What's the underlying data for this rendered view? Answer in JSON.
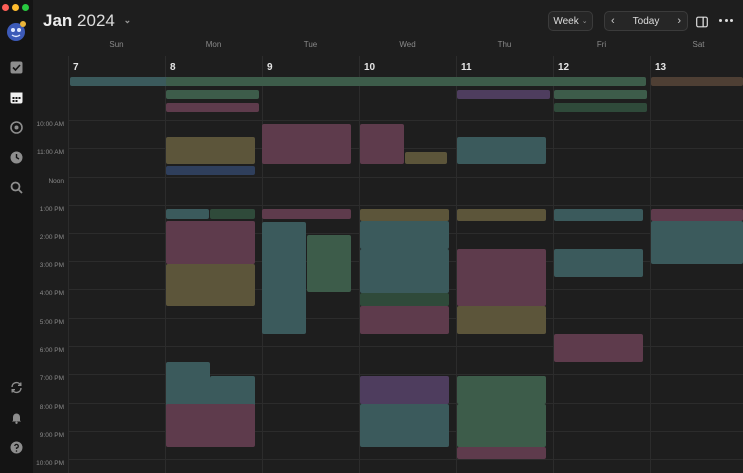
{
  "header": {
    "month": "Jan",
    "year": "2024",
    "view_label": "Week",
    "today_label": "Today"
  },
  "days": [
    {
      "name": "Sun",
      "date": "7"
    },
    {
      "name": "Mon",
      "date": "8"
    },
    {
      "name": "Tue",
      "date": "9"
    },
    {
      "name": "Wed",
      "date": "10"
    },
    {
      "name": "Thu",
      "date": "11"
    },
    {
      "name": "Fri",
      "date": "12"
    },
    {
      "name": "Sat",
      "date": "13"
    }
  ],
  "times": [
    "10:00 AM",
    "11:00 AM",
    "Noon",
    "1:00 PM",
    "2:00 PM",
    "3:00 PM",
    "4:00 PM",
    "5:00 PM",
    "6:00 PM",
    "7:00 PM",
    "8:00 PM",
    "9:00 PM",
    "10:00 PM"
  ],
  "colors": {
    "red": "#ff5f57",
    "yellow": "#febc2e",
    "green": "#28c840"
  },
  "icons": [
    "app-logo-icon",
    "checkbox-icon",
    "calendar-icon",
    "target-icon",
    "clock-icon",
    "search-icon",
    "sync-icon",
    "bell-icon",
    "help-icon"
  ],
  "events": [
    {
      "title": "",
      "sub": "",
      "color": "teal"
    },
    {
      "title": "",
      "sub": "",
      "color": "green"
    },
    {
      "title": "",
      "sub": "",
      "color": "green"
    },
    {
      "title": "",
      "sub": "",
      "color": "pink"
    },
    {
      "title": "",
      "sub": "",
      "color": "purple"
    },
    {
      "title": "",
      "sub": "",
      "color": "green"
    },
    {
      "title": "",
      "sub": "",
      "color": "dgreen"
    },
    {
      "title": "",
      "sub": "",
      "color": "brown"
    },
    {
      "title": "",
      "sub": "",
      "color": "olive"
    },
    {
      "title": "",
      "sub": "",
      "color": "blue"
    },
    {
      "title": "",
      "sub": "",
      "color": "pink"
    },
    {
      "title": "",
      "sub": "",
      "color": "pink"
    },
    {
      "title": "",
      "sub": "",
      "color": "olive"
    },
    {
      "title": "",
      "sub": "",
      "color": "teal"
    },
    {
      "title": "",
      "sub": "",
      "color": "teal"
    },
    {
      "title": "",
      "sub": "",
      "color": "dgreen"
    },
    {
      "title": "",
      "sub": "",
      "color": "pink"
    },
    {
      "title": "",
      "sub": "",
      "color": "olive"
    },
    {
      "title": "",
      "sub": "",
      "color": "pink"
    },
    {
      "title": "",
      "sub": "",
      "color": "teal"
    },
    {
      "title": "",
      "sub": "",
      "color": "green"
    },
    {
      "title": "",
      "sub": "",
      "color": "olive"
    },
    {
      "title": "",
      "sub": "",
      "color": "teal"
    },
    {
      "title": "",
      "sub": "",
      "color": "teal"
    },
    {
      "title": "",
      "sub": "",
      "color": "dgreen"
    },
    {
      "title": "",
      "sub": "",
      "color": "pink"
    },
    {
      "title": "",
      "sub": "",
      "color": "olive"
    },
    {
      "title": "",
      "sub": "",
      "color": "pink"
    },
    {
      "title": "",
      "sub": "",
      "color": "olive"
    },
    {
      "title": "",
      "sub": "",
      "color": "teal"
    },
    {
      "title": "",
      "sub": "",
      "color": "teal"
    },
    {
      "title": "",
      "sub": "",
      "color": "pink"
    },
    {
      "title": "",
      "sub": "",
      "color": "teal"
    },
    {
      "title": "",
      "sub": "",
      "color": "pink"
    },
    {
      "title": "",
      "sub": "",
      "color": "teal"
    },
    {
      "title": "",
      "sub": "",
      "color": "teal"
    },
    {
      "title": "",
      "sub": "",
      "color": "pink"
    },
    {
      "title": "",
      "sub": "",
      "color": "purple"
    }
  ]
}
